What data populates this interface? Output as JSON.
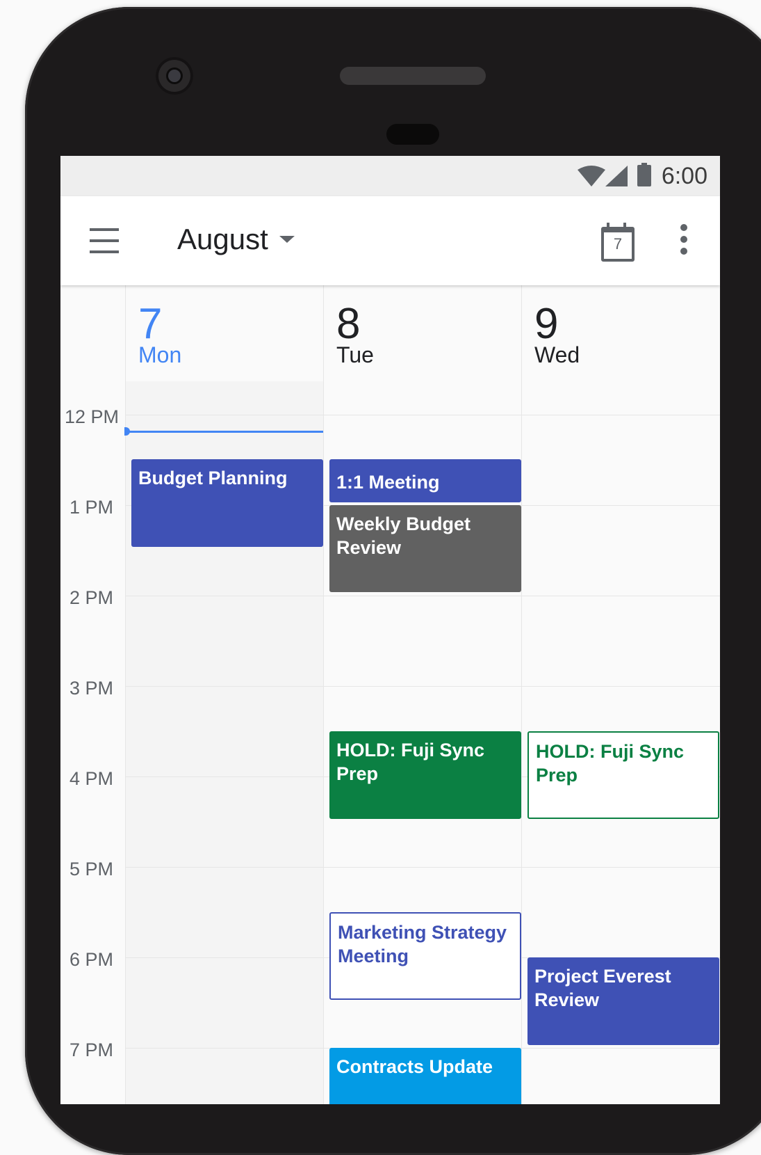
{
  "status_bar": {
    "time": "6:00"
  },
  "app_bar": {
    "month": "August",
    "today_number": "7"
  },
  "days": [
    {
      "number": "7",
      "name": "Mon",
      "is_today": true
    },
    {
      "number": "8",
      "name": "Tue",
      "is_today": false
    },
    {
      "number": "9",
      "name": "Wed",
      "is_today": false
    }
  ],
  "hours": [
    "12 PM",
    "1 PM",
    "2 PM",
    "3 PM",
    "4 PM",
    "5 PM",
    "6 PM",
    "7 PM"
  ],
  "events": [
    {
      "title": "Budget Planning",
      "day": "Mon",
      "color": "#3f51b5",
      "style": "filled"
    },
    {
      "title": "1:1 Meeting",
      "day": "Tue",
      "color": "#3f51b5",
      "style": "filled"
    },
    {
      "title": "Weekly Budget Review",
      "day": "Tue",
      "color": "#616161",
      "style": "filled"
    },
    {
      "title": "HOLD: Fuji Sync Prep",
      "day": "Tue",
      "color": "#0b8043",
      "style": "filled"
    },
    {
      "title": "HOLD: Fuji Sync Prep",
      "day": "Wed",
      "color": "#0b8043",
      "style": "outlined"
    },
    {
      "title": "Marketing Strategy Meeting",
      "day": "Tue",
      "color": "#3f51b5",
      "style": "outlined"
    },
    {
      "title": "Project Everest Review",
      "day": "Wed",
      "color": "#3f51b5",
      "style": "filled"
    },
    {
      "title": "Contracts Update",
      "day": "Tue",
      "color": "#039be5",
      "style": "filled"
    }
  ],
  "colors": {
    "accent": "#4285f4",
    "now_line": "#4285f4"
  }
}
